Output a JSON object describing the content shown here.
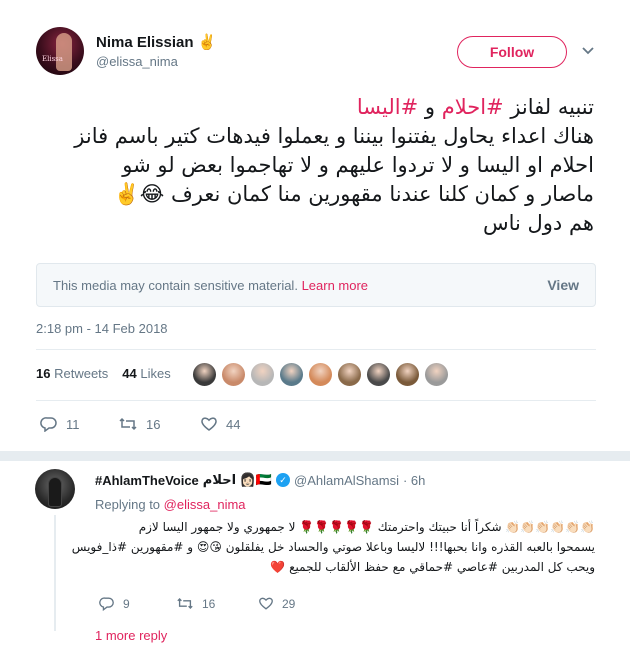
{
  "tweet": {
    "author_name": "Nima Elissian",
    "author_emoji": "✌️",
    "author_handle": "@elissa_nima",
    "follow_label": "Follow",
    "avatar_caption": "Elissa",
    "text": {
      "line1_prefix": "تنبيه لفانز",
      "hashtag1": "#احلام",
      "line1_mid": " و ",
      "hashtag2": "#اليسا",
      "line2": "هناك اعداء يحاول يفتنوا بيننا و يعملوا فيدهات كتير باسم فانز",
      "line3": "احلام او اليسا و لا تردوا عليهم و لا تهاجموا بعض لو شو",
      "line4": "ماصار و كمان كلنا عندنا مقهورين منا كمان نعرف 😂✌️",
      "line5": "هم دول ناس"
    },
    "media_warning": "This media may contain sensitive material.",
    "learn_more": "Learn more",
    "view_label": "View",
    "timestamp": "2:18 pm - 14 Feb 2018",
    "retweets_count": "16",
    "retweets_label": "Retweets",
    "likes_count": "44",
    "likes_label": "Likes",
    "liker_colors": [
      "#3a3a3a",
      "#c98a6a",
      "#b7b7b7",
      "#5a7a8a",
      "#d48a5a",
      "#8a6a4a",
      "#4a4a4a",
      "#7a5a3a",
      "#9a9a9a"
    ],
    "actions": {
      "reply_count": "11",
      "retweet_count": "16",
      "like_count": "44"
    }
  },
  "reply": {
    "name": "#AhlamTheVoice",
    "name_suffix": "احلام 👩🏻🇦🇪",
    "handle": "@AhlamAlShamsi",
    "time": "· 6h",
    "replying_label": "Replying to",
    "replying_handle": "@elissa_nima",
    "text": {
      "line1": "👏🏻👏🏻👏🏻👏🏻👏🏻👏🏻 شكراً أنا حبيتك واحترمتك 🌹🌹🌹🌹🌹 لا جمهوري ولا جمهور اليسا لازم",
      "line2": "يسمحوا بالعبه القذره وانا بحبها!!! لاليسا وباعلا صوتي والحساد خل يفلقلون 😘😍 و #مقهورين #ذا_فويس",
      "line3": "ويحب كل المدربين #عاصي #حماقي مع حفظ الألقاب للجميع ❤️"
    },
    "actions": {
      "reply_count": "9",
      "retweet_count": "16",
      "like_count": "29"
    },
    "more_replies": "1 more reply"
  }
}
